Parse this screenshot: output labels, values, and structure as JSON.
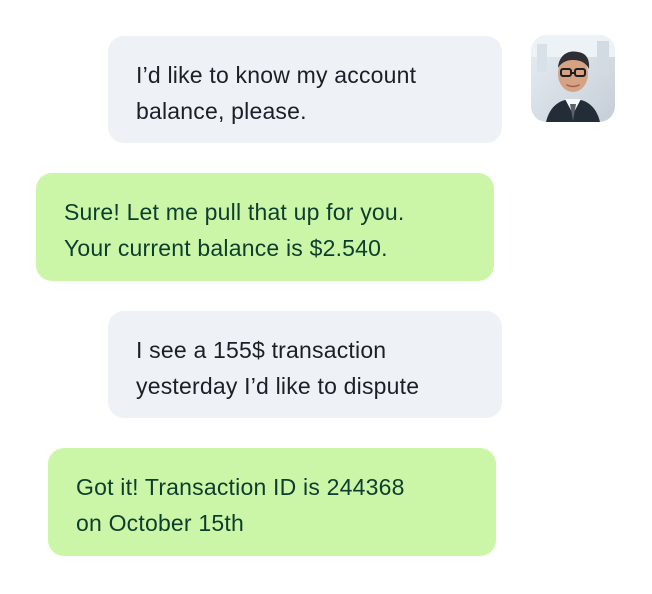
{
  "conversation": {
    "messages": [
      {
        "sender": "user",
        "text": "I’d like to know my account\nbalance, please."
      },
      {
        "sender": "bot",
        "text": "Sure! Let me pull that up for you.\nYour current balance is $2.540."
      },
      {
        "sender": "user",
        "text": "I see a 155$ transaction\nyesterday I’d like to dispute"
      },
      {
        "sender": "bot",
        "text": "Got it! Transaction ID is 244368\non October 15th"
      }
    ]
  },
  "colors": {
    "user_bubble": "#eef1f5",
    "bot_bubble": "#cbf6a7",
    "user_text": "#1b1f27",
    "bot_text": "#0d3d2e"
  },
  "icons": {
    "avatar": "user-avatar-photo"
  }
}
